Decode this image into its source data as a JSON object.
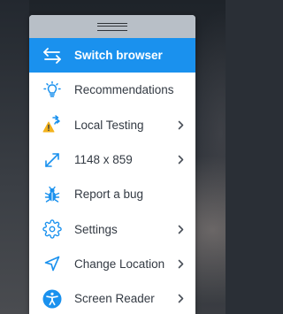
{
  "menu": {
    "items": [
      {
        "label": "Switch browser",
        "icon": "switch-arrows-icon",
        "active": true,
        "chevron": false
      },
      {
        "label": "Recommendations",
        "icon": "lightbulb-icon",
        "active": false,
        "chevron": false
      },
      {
        "label": "Local Testing",
        "icon": "local-testing-warning-icon",
        "active": false,
        "chevron": true
      },
      {
        "label": "1148 x 859",
        "icon": "resize-arrows-icon",
        "active": false,
        "chevron": true
      },
      {
        "label": "Report a bug",
        "icon": "bug-icon",
        "active": false,
        "chevron": false
      },
      {
        "label": "Settings",
        "icon": "gear-icon",
        "active": false,
        "chevron": true
      },
      {
        "label": "Change Location",
        "icon": "location-arrow-icon",
        "active": false,
        "chevron": true
      },
      {
        "label": "Screen Reader",
        "icon": "accessibility-icon",
        "active": false,
        "chevron": true
      }
    ]
  },
  "colors": {
    "accent": "#1a91ee",
    "icon": "#1a91ee",
    "warning": "#f3b21b",
    "text": "#333a43",
    "handle": "#b8bfc7"
  }
}
